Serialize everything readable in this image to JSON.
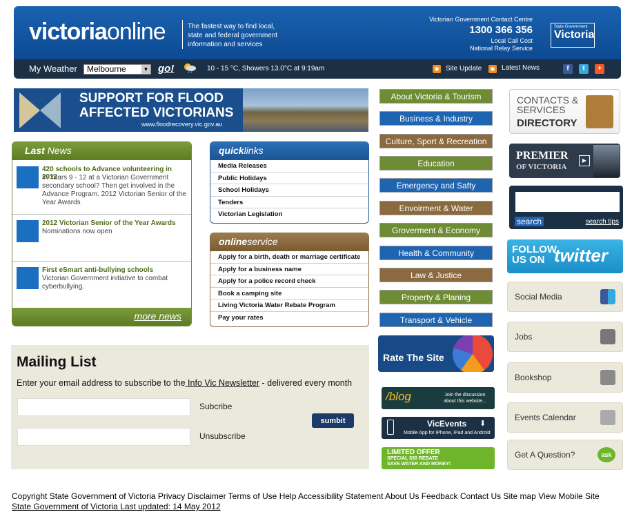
{
  "header": {
    "logo_bold": "victoria",
    "logo_light": "online",
    "tagline": "The fastest way to find local, state and federal government information and services",
    "contact_title": "Victorian Government Contact Centre",
    "phone": "1300 366 356",
    "local_call": "Local Call Cost",
    "relay": "National Relay Service",
    "vic_logo_small": "State Government",
    "vic_logo_big": "Victoria"
  },
  "weather": {
    "label": "My Weather",
    "selected_city": "Melbourne",
    "go": "go!",
    "forecast": "10 - 15 °C, Showers 13.0°C at 9:19am",
    "site_update": "Site Update",
    "latest_news": "Latest News"
  },
  "banner": {
    "line1": "SUPPORT FOR FLOOD",
    "line2": "AFFECTED VICTORIANS",
    "url": "www.floodrecovery.vic.gov.au"
  },
  "news": {
    "title_bold": "Last",
    "title_light": "News",
    "items": [
      {
        "title": "420 schools to Advance volunteering in 2012",
        "desc": "In Years 9 - 12 at a Victorian Government secondary school? Then get involved in the Advance Program. 2012 Victorian Senior of the Year Awards"
      },
      {
        "title": "2012 Victorian Senior of the Year Awards",
        "desc": "Nominations now open"
      },
      {
        "title": "First eSmart anti-bullying schools",
        "desc": "Victorian Government initiative to combat cyberbullying."
      }
    ],
    "more": "more news"
  },
  "quicklinks": {
    "title_bold": "quick",
    "title_light": "links",
    "items": [
      "Media Releases",
      "Public Holidays",
      "School Holidays",
      "Tenders",
      "Victorian Legislation"
    ]
  },
  "onlineservice": {
    "title_bold": "online",
    "title_light": "service",
    "items": [
      "Apply for a birth, death or marriage certificate",
      "Apply for a business name",
      "Apply for a police record check",
      "Book a camping site",
      "Living Victoria Water Rebate Program",
      "Pay your rates"
    ]
  },
  "categories": [
    "About Victoria & Tourism",
    "Business & Industry",
    "Culture, Sport & Recreation",
    "Education",
    "Emergency and Safty",
    "Envoirment & Water",
    "Groverment & Economy",
    "Health & Community",
    "Law & Justice",
    "Property &  Planing",
    "Transport & Vehicle"
  ],
  "rate": "Rate The Site",
  "blog": {
    "title": "/blog",
    "sub": "Join the discussion about this website..."
  },
  "vicevents": {
    "title": "VicEvents",
    "sub": "Mobile App for iPhone, iPad and Android"
  },
  "limited": {
    "a": "LIMITED OFFER",
    "b": "SPECIAL $30 REBATE",
    "c": "SAVE WATER AND MONEY!"
  },
  "contacts": {
    "line1": "CONTACTS &",
    "line2": "SERVICES",
    "line3": "DIRECTORY"
  },
  "premier": {
    "line1": "PREMIER",
    "line2": "OF VICTORIA"
  },
  "search": {
    "button": "search",
    "tips": "search tips"
  },
  "twitter": {
    "follow": "FOLLOW",
    "us_on": "US ON",
    "brand": "twitter"
  },
  "right_links": [
    "Social Media",
    "Jobs",
    "Bookshop",
    "Events Calendar",
    "Get A Question?"
  ],
  "mailing": {
    "title": "Mailing List",
    "desc_before": "Enter your email address to subscribe to the",
    "desc_link": " Info Vic Newsletter",
    "desc_after": " - delivered every month",
    "subscribe": "Subcribe",
    "unsubscribe": "Unsubscribe",
    "submit": "sumbit"
  },
  "footer": {
    "links": "Copyright State Government of Victoria Privacy Disclaimer Terms of Use Help Accessibility Statement About Us Feedback Contact Us Site map View Mobile Site",
    "updated": "State Government of Victoria Last updated: 14 May 2012"
  }
}
